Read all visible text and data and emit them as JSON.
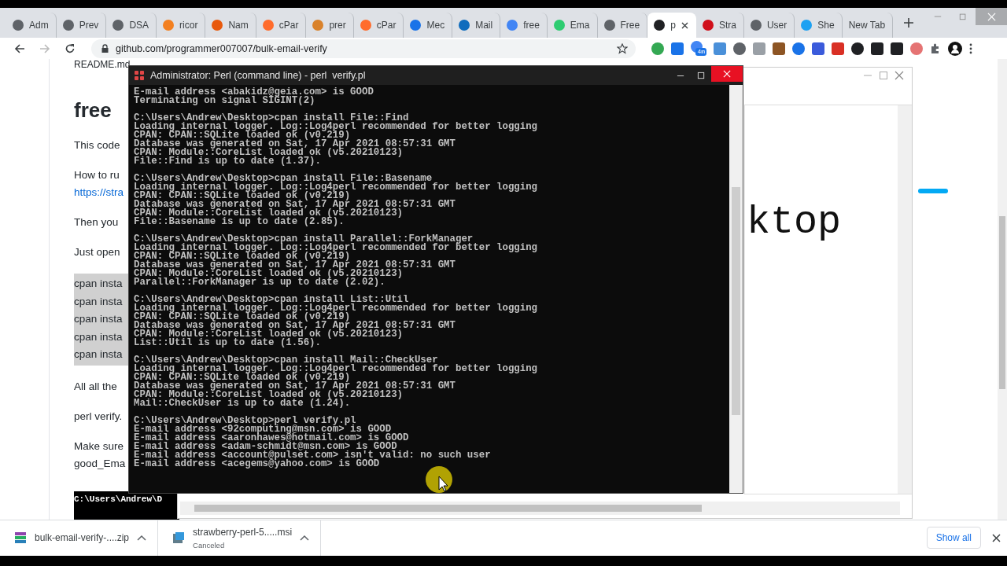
{
  "browser": {
    "tabs": [
      {
        "label": "Adm",
        "selected": false,
        "color": "#5f6368"
      },
      {
        "label": "Prev",
        "selected": false,
        "color": "#5f6368"
      },
      {
        "label": "DSA",
        "selected": false,
        "color": "#5f6368"
      },
      {
        "label": "ricor",
        "selected": false,
        "color": "#f38020"
      },
      {
        "label": "Nam",
        "selected": false,
        "color": "#e8590c"
      },
      {
        "label": "cPar",
        "selected": false,
        "color": "#ff6c2c"
      },
      {
        "label": "prer",
        "selected": false,
        "color": "#d9822b"
      },
      {
        "label": "cPar",
        "selected": false,
        "color": "#ff6c2c"
      },
      {
        "label": "Mec",
        "selected": false,
        "color": "#1a73e8"
      },
      {
        "label": "Mail",
        "selected": false,
        "color": "#0f6cbd"
      },
      {
        "label": "free",
        "selected": false,
        "color": "#4285f4"
      },
      {
        "label": "Ema",
        "selected": false,
        "color": "#2ecc71"
      },
      {
        "label": "Free",
        "selected": false,
        "color": "#5f6368"
      },
      {
        "label": "p",
        "selected": true,
        "color": "#202124"
      },
      {
        "label": "Stra",
        "selected": false,
        "color": "#d0101b"
      },
      {
        "label": "User",
        "selected": false,
        "color": "#5f6368"
      },
      {
        "label": "She",
        "selected": false,
        "color": "#1da1f2"
      },
      {
        "label": "New Tab",
        "selected": false
      }
    ],
    "address": "github.com/programmer007007/bulk-email-verify",
    "extension_badge": "4m"
  },
  "page": {
    "file_label": "README.md",
    "heading": "free",
    "blocks": [
      {
        "kind": "paragraph",
        "lines": [
          "This code"
        ]
      },
      {
        "kind": "paragraph",
        "lines": [
          "How to ru"
        ],
        "link": "https://stra"
      },
      {
        "kind": "paragraph",
        "lines": [
          "Then you"
        ]
      },
      {
        "kind": "paragraph",
        "lines": [
          "Just open"
        ]
      },
      {
        "kind": "code",
        "lines": [
          "cpan insta",
          "cpan insta",
          "cpan insta",
          "cpan insta",
          "cpan insta"
        ]
      },
      {
        "kind": "paragraph",
        "lines": [
          "All all the"
        ]
      },
      {
        "kind": "paragraph",
        "lines": [
          "perl verify."
        ]
      },
      {
        "kind": "paragraph",
        "lines": [
          "Make sure",
          "good_Ema"
        ]
      },
      {
        "kind": "terminal",
        "lines": [
          "C:\\Users\\Andrew\\D"
        ]
      }
    ]
  },
  "back_window": {
    "big_text": "ktop"
  },
  "console": {
    "title": "Administrator: Perl (command line) - perl  verify.pl",
    "blocks": [
      [
        "E-mail address <abakidz@geia.com> is GOOD",
        "Terminating on signal SIGINT(2)"
      ],
      [
        "C:\\Users\\Andrew\\Desktop>cpan install File::Find",
        "Loading internal logger. Log::Log4perl recommended for better logging",
        "CPAN: CPAN::SQLite loaded ok (v0.219)",
        "Database was generated on Sat, 17 Apr 2021 08:57:31 GMT",
        "CPAN: Module::CoreList loaded ok (v5.20210123)",
        "File::Find is up to date (1.37)."
      ],
      [
        "C:\\Users\\Andrew\\Desktop>cpan install File::Basename",
        "Loading internal logger. Log::Log4perl recommended for better logging",
        "CPAN: CPAN::SQLite loaded ok (v0.219)",
        "Database was generated on Sat, 17 Apr 2021 08:57:31 GMT",
        "CPAN: Module::CoreList loaded ok (v5.20210123)",
        "File::Basename is up to date (2.85)."
      ],
      [
        "C:\\Users\\Andrew\\Desktop>cpan install Parallel::ForkManager",
        "Loading internal logger. Log::Log4perl recommended for better logging",
        "CPAN: CPAN::SQLite loaded ok (v0.219)",
        "Database was generated on Sat, 17 Apr 2021 08:57:31 GMT",
        "CPAN: Module::CoreList loaded ok (v5.20210123)",
        "Parallel::ForkManager is up to date (2.02)."
      ],
      [
        "C:\\Users\\Andrew\\Desktop>cpan install List::Util",
        "Loading internal logger. Log::Log4perl recommended for better logging",
        "CPAN: CPAN::SQLite loaded ok (v0.219)",
        "Database was generated on Sat, 17 Apr 2021 08:57:31 GMT",
        "CPAN: Module::CoreList loaded ok (v5.20210123)",
        "List::Util is up to date (1.56)."
      ],
      [
        "C:\\Users\\Andrew\\Desktop>cpan install Mail::CheckUser",
        "Loading internal logger. Log::Log4perl recommended for better logging",
        "CPAN: CPAN::SQLite loaded ok (v0.219)",
        "Database was generated on Sat, 17 Apr 2021 08:57:31 GMT",
        "CPAN: Module::CoreList loaded ok (v5.20210123)",
        "Mail::CheckUser is up to date (1.24)."
      ],
      [
        "C:\\Users\\Andrew\\Desktop>perl verify.pl",
        "E-mail address <92computing@msn.com> is GOOD",
        "E-mail address <aaronhawes@hotmail.com> is GOOD",
        "E-mail address <adam-schmidt@msn.com> is GOOD",
        "E-mail address <account@pulset.com> isn't valid: no such user",
        "E-mail address <acegems@yahoo.com> is GOOD"
      ]
    ]
  },
  "downloads": {
    "items": [
      {
        "name": "bulk-email-verify-....zip",
        "kind": "archive"
      },
      {
        "name": "strawberry-perl-5.....msi",
        "status": "Canceled",
        "kind": "installer"
      }
    ],
    "show_all": "Show all"
  }
}
